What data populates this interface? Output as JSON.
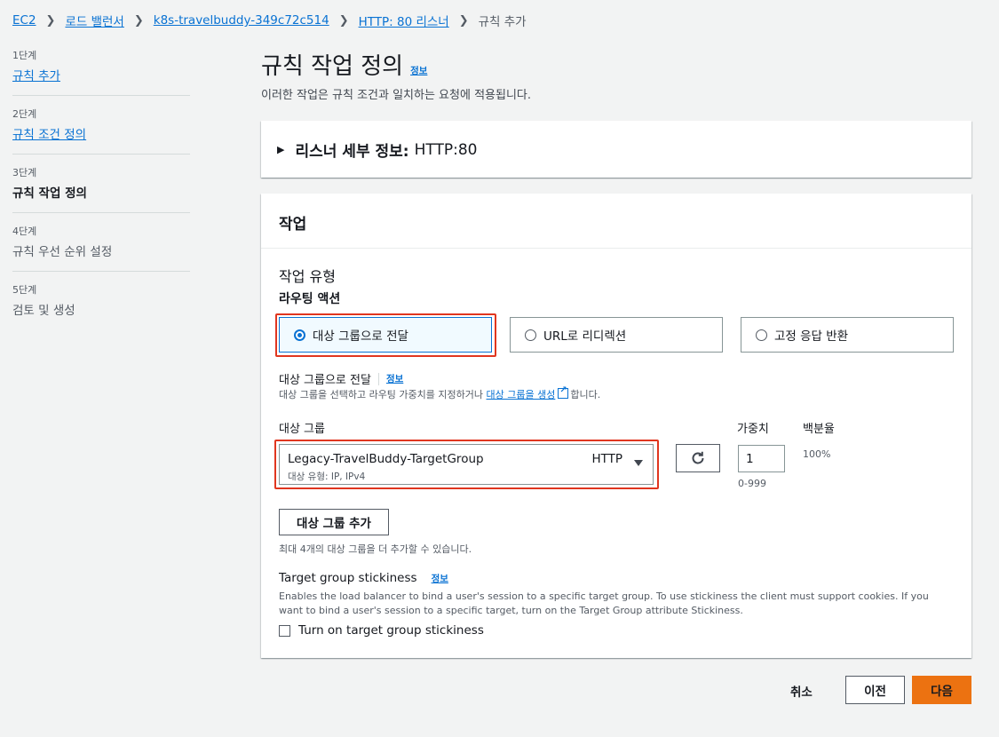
{
  "breadcrumb": {
    "items": [
      "EC2",
      "로드 밸런서",
      "k8s-travelbuddy-349c72c514",
      "HTTP: 80 리스너"
    ],
    "current": "규칙 추가"
  },
  "steps": [
    {
      "num": "1단계",
      "title": "규칙 추가"
    },
    {
      "num": "2단계",
      "title": "규칙 조건 정의"
    },
    {
      "num": "3단계",
      "title": "규칙 작업 정의"
    },
    {
      "num": "4단계",
      "title": "규칙 우선 순위 설정"
    },
    {
      "num": "5단계",
      "title": "검토 및 생성"
    }
  ],
  "header": {
    "title": "규칙 작업 정의",
    "info": "정보",
    "description": "이러한 작업은 규칙 조건과 일치하는 요청에 적용됩니다."
  },
  "listener": {
    "label": "리스너 세부 정보:",
    "value": "HTTP:80"
  },
  "action": {
    "heading": "작업",
    "type_label": "작업 유형",
    "routing_label": "라우팅 액션",
    "options": [
      "대상 그룹으로 전달",
      "URL로 리디렉션",
      "고정 응답 반환"
    ],
    "selected_option": "대상 그룹으로 전달",
    "forward": {
      "label": "대상 그룹으로 전달",
      "info": "정보",
      "desc_prefix": "대상 그룹을 선택하고 라우팅 가중치를 지정하거나",
      "desc_link": "대상 그룹을 생성",
      "desc_suffix": "합니다."
    },
    "target_group": {
      "label": "대상 그룹",
      "name": "Legacy-TravelBuddy-TargetGroup",
      "protocol": "HTTP",
      "sub": "대상 유형: IP, IPv4"
    },
    "weight": {
      "label": "가중치",
      "value": "1",
      "hint": "0-999"
    },
    "percentage": {
      "label": "백분율",
      "value": "100%"
    },
    "add_tg_button": "대상 그룹 추가",
    "add_tg_hint": "최대 4개의 대상 그룹을 더 추가할 수 있습니다.",
    "stickiness": {
      "label": "Target group stickiness",
      "info": "정보",
      "desc": "Enables the load balancer to bind a user's session to a specific target group. To use stickiness the client must support cookies. If you want to bind a user's session to a specific target, turn on the Target Group attribute Stickiness.",
      "checkbox_label": "Turn on target group stickiness",
      "checked": false
    }
  },
  "footer": {
    "cancel": "취소",
    "previous": "이전",
    "next": "다음"
  },
  "colors": {
    "link": "#0972d3",
    "primary_button": "#ec7211",
    "highlight": "#e0361f",
    "selected_tile_bg": "#f1faff"
  }
}
